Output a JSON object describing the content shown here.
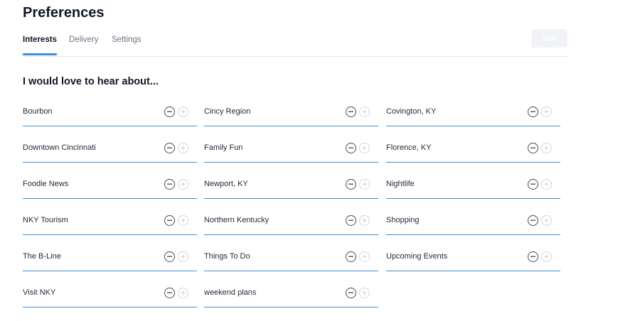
{
  "page": {
    "title": "Preferences"
  },
  "tabs": [
    {
      "label": "Interests",
      "active": true
    },
    {
      "label": "Delivery",
      "active": false
    },
    {
      "label": "Settings",
      "active": false
    }
  ],
  "toolbar": {
    "save_label": "Save"
  },
  "section": {
    "heading": "I would love to hear about..."
  },
  "interests": [
    "Bourbon",
    "Cincy Region",
    "Covington, KY",
    "Downtown Cincinnati",
    "Family Fun",
    "Florence, KY",
    "Foodie News",
    "Newport, KY",
    "Nightlife",
    "NKY Tourism",
    "Northern Kentucky",
    "Shopping",
    "The B-Line",
    "Things To Do",
    "Upcoming Events",
    "Visit NKY",
    "weekend plans"
  ],
  "colors": {
    "accent": "#3b8fd6",
    "text": "#1f2937",
    "muted": "#6b7280"
  },
  "icons": {
    "remove": "minus-circle-icon",
    "add": "plus-circle-icon"
  }
}
